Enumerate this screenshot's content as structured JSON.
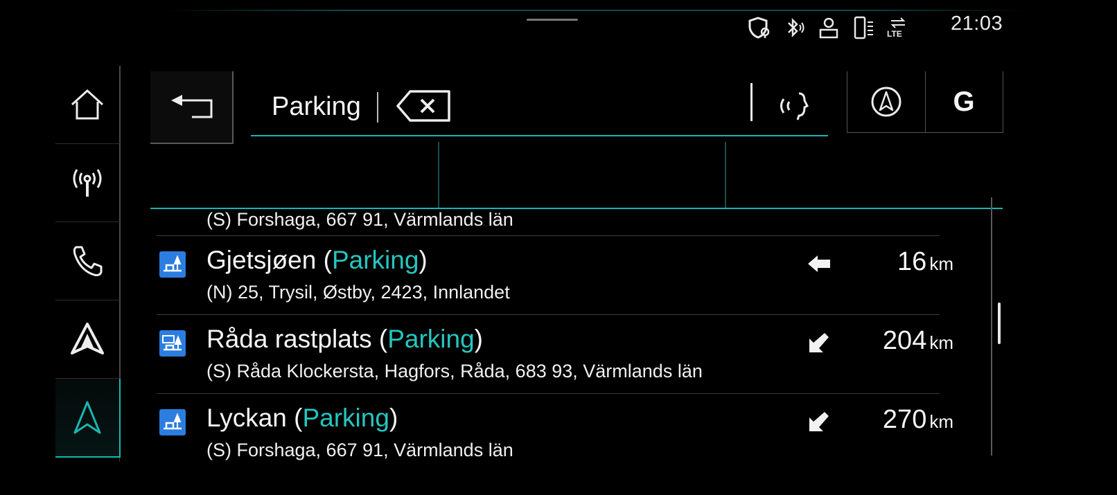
{
  "status_bar": {
    "icons": [
      "location-privacy-icon",
      "bluetooth-icon",
      "user-profile-icon",
      "phone-signal-icon",
      "lte-icon"
    ],
    "lte_label": "LTE",
    "time": "21:03"
  },
  "rail": {
    "items": [
      {
        "icon": "home-icon",
        "active": false
      },
      {
        "icon": "radio-icon",
        "active": false
      },
      {
        "icon": "phone-icon",
        "active": false
      },
      {
        "icon": "android-auto-icon",
        "active": false
      },
      {
        "icon": "navigation-icon",
        "active": true
      }
    ]
  },
  "search": {
    "query": "Parking",
    "clear_icon": "clear-backspace-icon",
    "voice_icon": "voice-input-icon"
  },
  "header_buttons": {
    "compass_icon": "north-compass-icon",
    "google_label": "G"
  },
  "results": [
    {
      "partial": true,
      "subtitle": "(S) Forshaga, 667 91, Värmlands län"
    },
    {
      "name": "Gjetsjøen",
      "open_paren": " (",
      "category": "Parking",
      "close_paren": ")",
      "subtitle": "(N) 25, Trysil, Østby, 2423, Innlandet",
      "direction": "left",
      "distance": "16",
      "unit": "km"
    },
    {
      "name": "Råda rastplats",
      "open_paren": " (",
      "category": "Parking",
      "close_paren": ")",
      "subtitle": "(S) Råda Klockersta, Hagfors, Råda, 683 93, Värmlands län",
      "direction": "down-left",
      "distance": "204",
      "unit": "km"
    },
    {
      "name": "Lyckan",
      "open_paren": " (",
      "category": "Parking",
      "close_paren": ")",
      "subtitle": "(S) Forshaga, 667 91, Värmlands län",
      "direction": "down-left",
      "distance": "270",
      "unit": "km"
    }
  ],
  "colors": {
    "accent": "#1ab6b0",
    "category_text": "#25c6c0",
    "poi_icon_bg": "#2b7de0",
    "background": "#000000"
  }
}
